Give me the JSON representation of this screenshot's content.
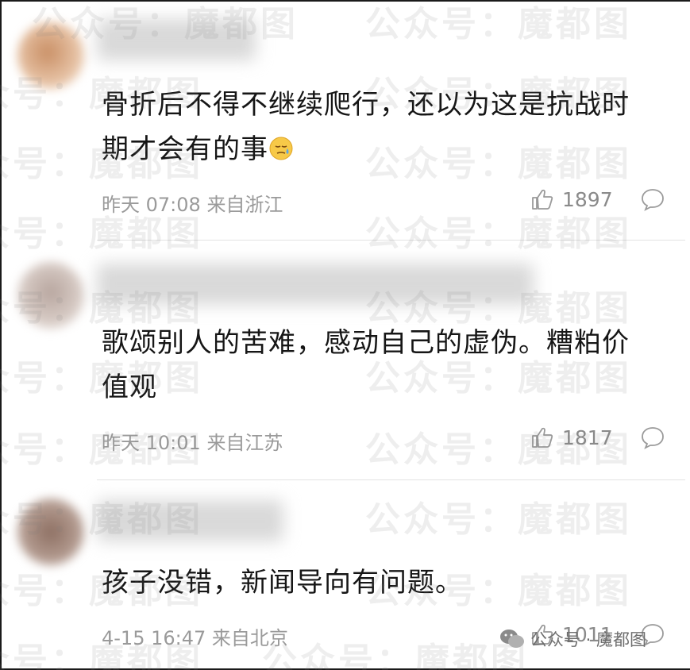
{
  "comments": [
    {
      "text": "骨折后不得不继续爬行，还以为这是抗战时期才会有的事",
      "emoji": "sad-sweat-emoji",
      "time": "昨天 07:08",
      "location": "来自浙江",
      "likes": "1897"
    },
    {
      "text": "歌颂别人的苦难，感动自己的虚伪。糟粕价值观",
      "time": "昨天 10:01",
      "location": "来自江苏",
      "likes": "1817"
    },
    {
      "text": "孩子没错，新闻导向有问题。",
      "time": "4-15 16:47",
      "location": "来自北京",
      "likes": "1011"
    }
  ],
  "watermark": "公众号：魔都图",
  "brand": {
    "label": "公众号 · 魔都图",
    "icon": "wechat-icon"
  },
  "colors": {
    "meta": "#9a9a9a",
    "text": "#161616",
    "divider": "#e3e3e3"
  }
}
